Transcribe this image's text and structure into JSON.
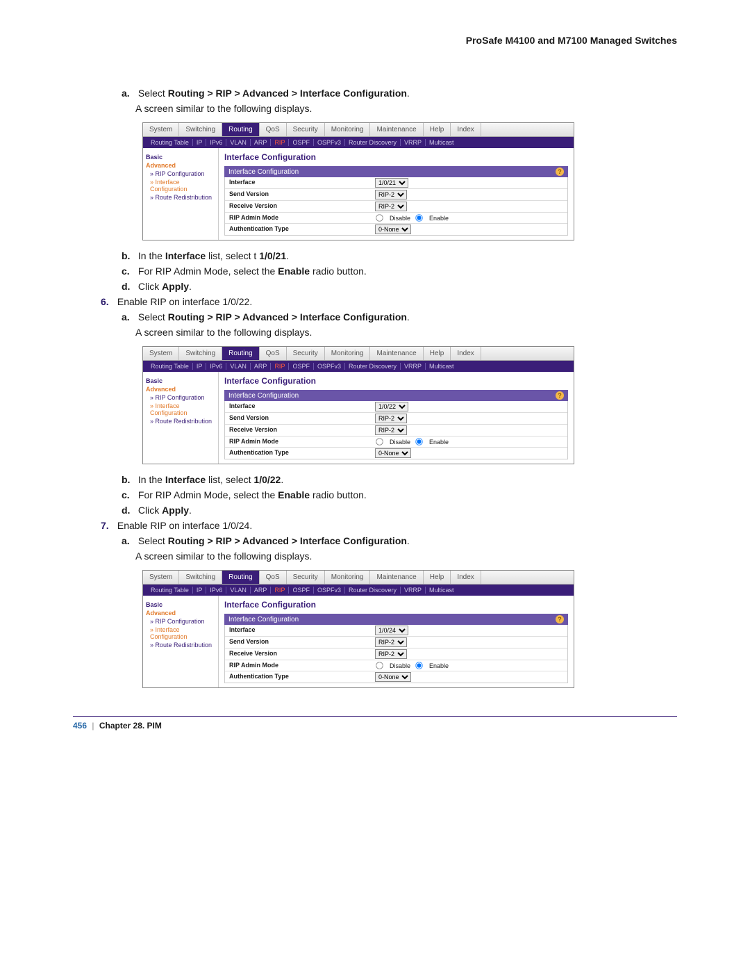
{
  "header": {
    "title": "ProSafe M4100 and M7100 Managed Switches"
  },
  "steps": {
    "a1": {
      "letter": "a.",
      "prefix": "Select ",
      "bold": "Routing > RIP > Advanced > Interface Configuration",
      "suffix": "."
    },
    "a1b": "A screen similar to the following displays.",
    "b1": {
      "letter": "b.",
      "t1": "In the ",
      "b1": "Interface",
      "t2": " list, select t ",
      "b2": "1/0/21",
      "t3": "."
    },
    "c1": {
      "letter": "c.",
      "t1": "For RIP Admin Mode, select the ",
      "b1": "Enable",
      "t2": " radio button."
    },
    "d1": {
      "letter": "d.",
      "t1": "Click ",
      "b1": "Apply",
      "t2": "."
    },
    "s6": {
      "num": "6.",
      "text": "Enable RIP on interface 1/0/22."
    },
    "a2": {
      "letter": "a.",
      "prefix": "Select ",
      "bold": "Routing > RIP > Advanced > Interface Configuration",
      "suffix": "."
    },
    "a2b": "A screen similar to the following displays.",
    "b2": {
      "letter": "b.",
      "t1": "In the ",
      "b1": "Interface",
      "t2": " list, select ",
      "b2": "1/0/22",
      "t3": "."
    },
    "c2": {
      "letter": "c.",
      "t1": "For RIP Admin Mode, select the ",
      "b1": "Enable",
      "t2": " radio button."
    },
    "d2": {
      "letter": "d.",
      "t1": "Click ",
      "b1": "Apply",
      "t2": "."
    },
    "s7": {
      "num": "7.",
      "text": "Enable RIP on interface 1/0/24."
    },
    "a3": {
      "letter": "a.",
      "prefix": "Select ",
      "bold": "Routing > RIP > Advanced > Interface Configuration",
      "suffix": "."
    },
    "a3b": "A screen similar to the following displays."
  },
  "ui": {
    "tabs1": [
      "System",
      "Switching",
      "Routing",
      "QoS",
      "Security",
      "Monitoring",
      "Maintenance",
      "Help",
      "Index"
    ],
    "tabs1_active": "Routing",
    "tabs2": [
      "Routing Table",
      "IP",
      "IPv6",
      "VLAN",
      "ARP",
      "RIP",
      "OSPF",
      "OSPFv3",
      "Router Discovery",
      "VRRP",
      "Multicast"
    ],
    "tabs2_hl": "RIP",
    "side": {
      "basic": "Basic",
      "adv": "Advanced",
      "items": [
        "» RIP Configuration",
        "» Interface Configuration",
        "» Route Redistribution"
      ],
      "hl_index": 1
    },
    "main_title": "Interface Configuration",
    "section_title": "Interface Configuration",
    "help_icon": "?",
    "rows": {
      "interface": "Interface",
      "send": "Send Version",
      "recv": "Receive Version",
      "admin": "RIP Admin Mode",
      "auth": "Authentication Type",
      "send_val": "RIP-2",
      "recv_val": "RIP-2",
      "disable": "Disable",
      "enable": "Enable",
      "auth_val": "0-None"
    }
  },
  "shots": {
    "s1_interface": "1/0/21",
    "s2_interface": "1/0/22",
    "s3_interface": "1/0/24"
  },
  "footer": {
    "page": "456",
    "chapter": "Chapter 28.  PIM"
  }
}
